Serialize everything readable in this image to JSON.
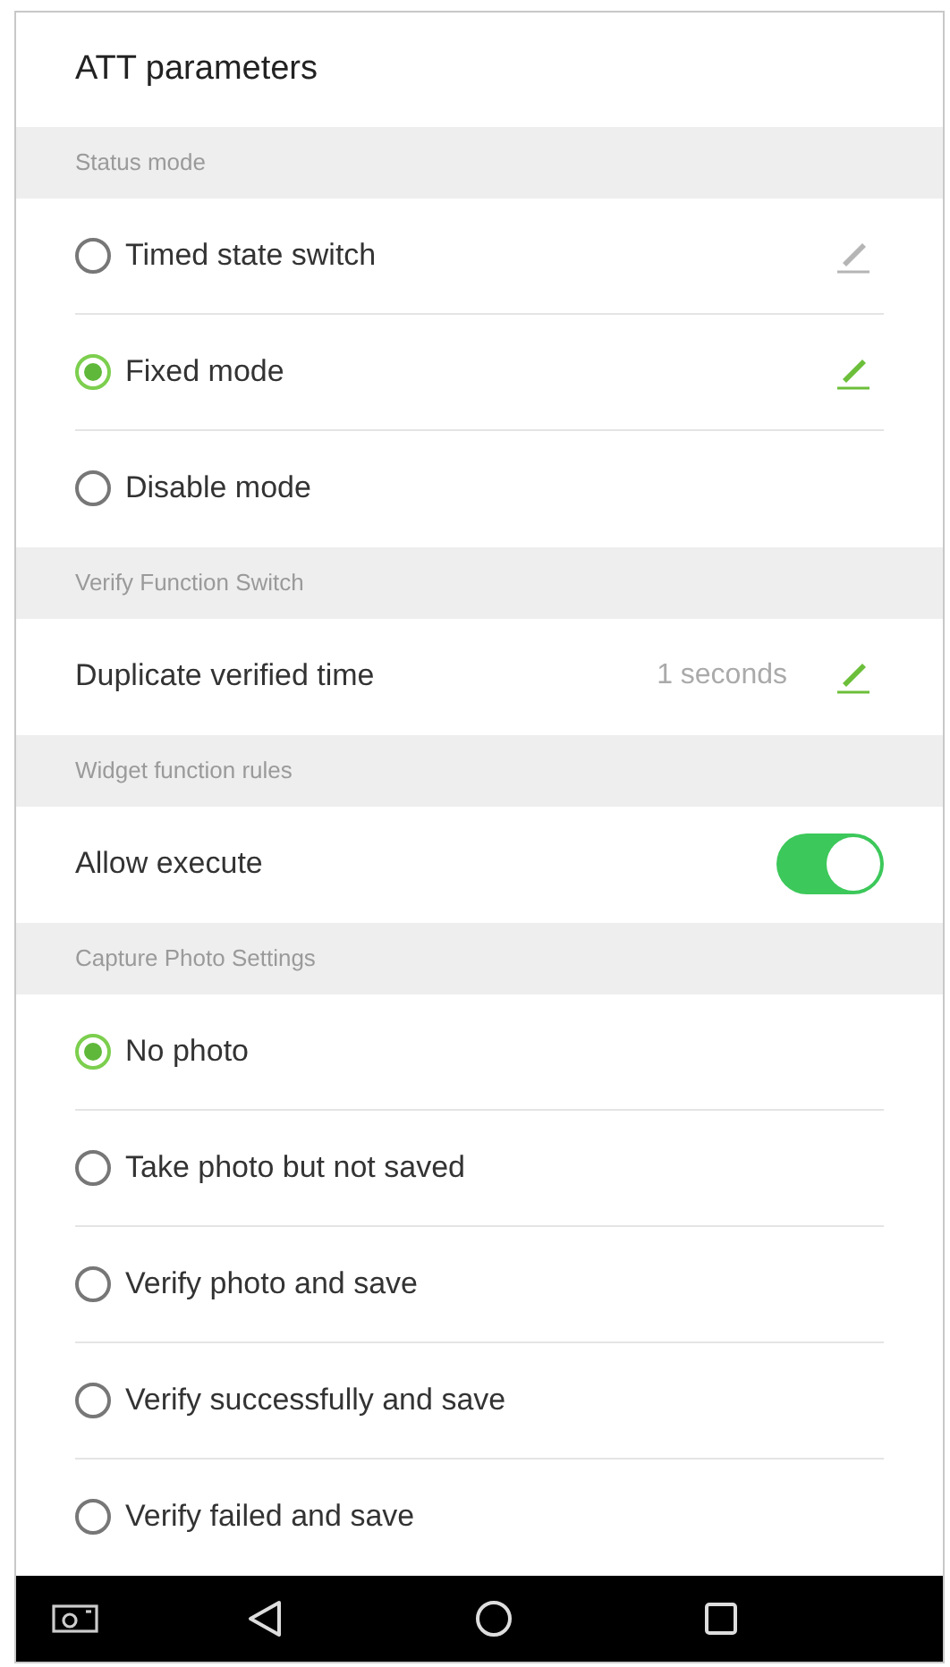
{
  "title": "ATT parameters",
  "sections": [
    {
      "header": "Status mode",
      "rows": [
        {
          "kind": "radio",
          "label": "Timed state switch",
          "selected": false,
          "editable": true
        },
        {
          "kind": "radio",
          "label": "Fixed mode",
          "selected": true,
          "editable": true
        },
        {
          "kind": "radio",
          "label": "Disable mode",
          "selected": false,
          "editable": false
        }
      ]
    },
    {
      "header": "Verify Function Switch",
      "rows": [
        {
          "kind": "value",
          "label": "Duplicate verified time",
          "value": "1 seconds",
          "editable": true
        }
      ]
    },
    {
      "header": "Widget function rules",
      "rows": [
        {
          "kind": "toggle",
          "label": "Allow execute",
          "on": true
        }
      ]
    },
    {
      "header": "Capture Photo Settings",
      "rows": [
        {
          "kind": "radio",
          "label": "No photo",
          "selected": true,
          "editable": false
        },
        {
          "kind": "radio",
          "label": "Take photo but not saved",
          "selected": false,
          "editable": false
        },
        {
          "kind": "radio",
          "label": "Verify photo and save",
          "selected": false,
          "editable": false
        },
        {
          "kind": "radio",
          "label": "Verify successfully and save",
          "selected": false,
          "editable": false
        },
        {
          "kind": "radio",
          "label": "Verify failed and save",
          "selected": false,
          "editable": false
        }
      ]
    }
  ]
}
